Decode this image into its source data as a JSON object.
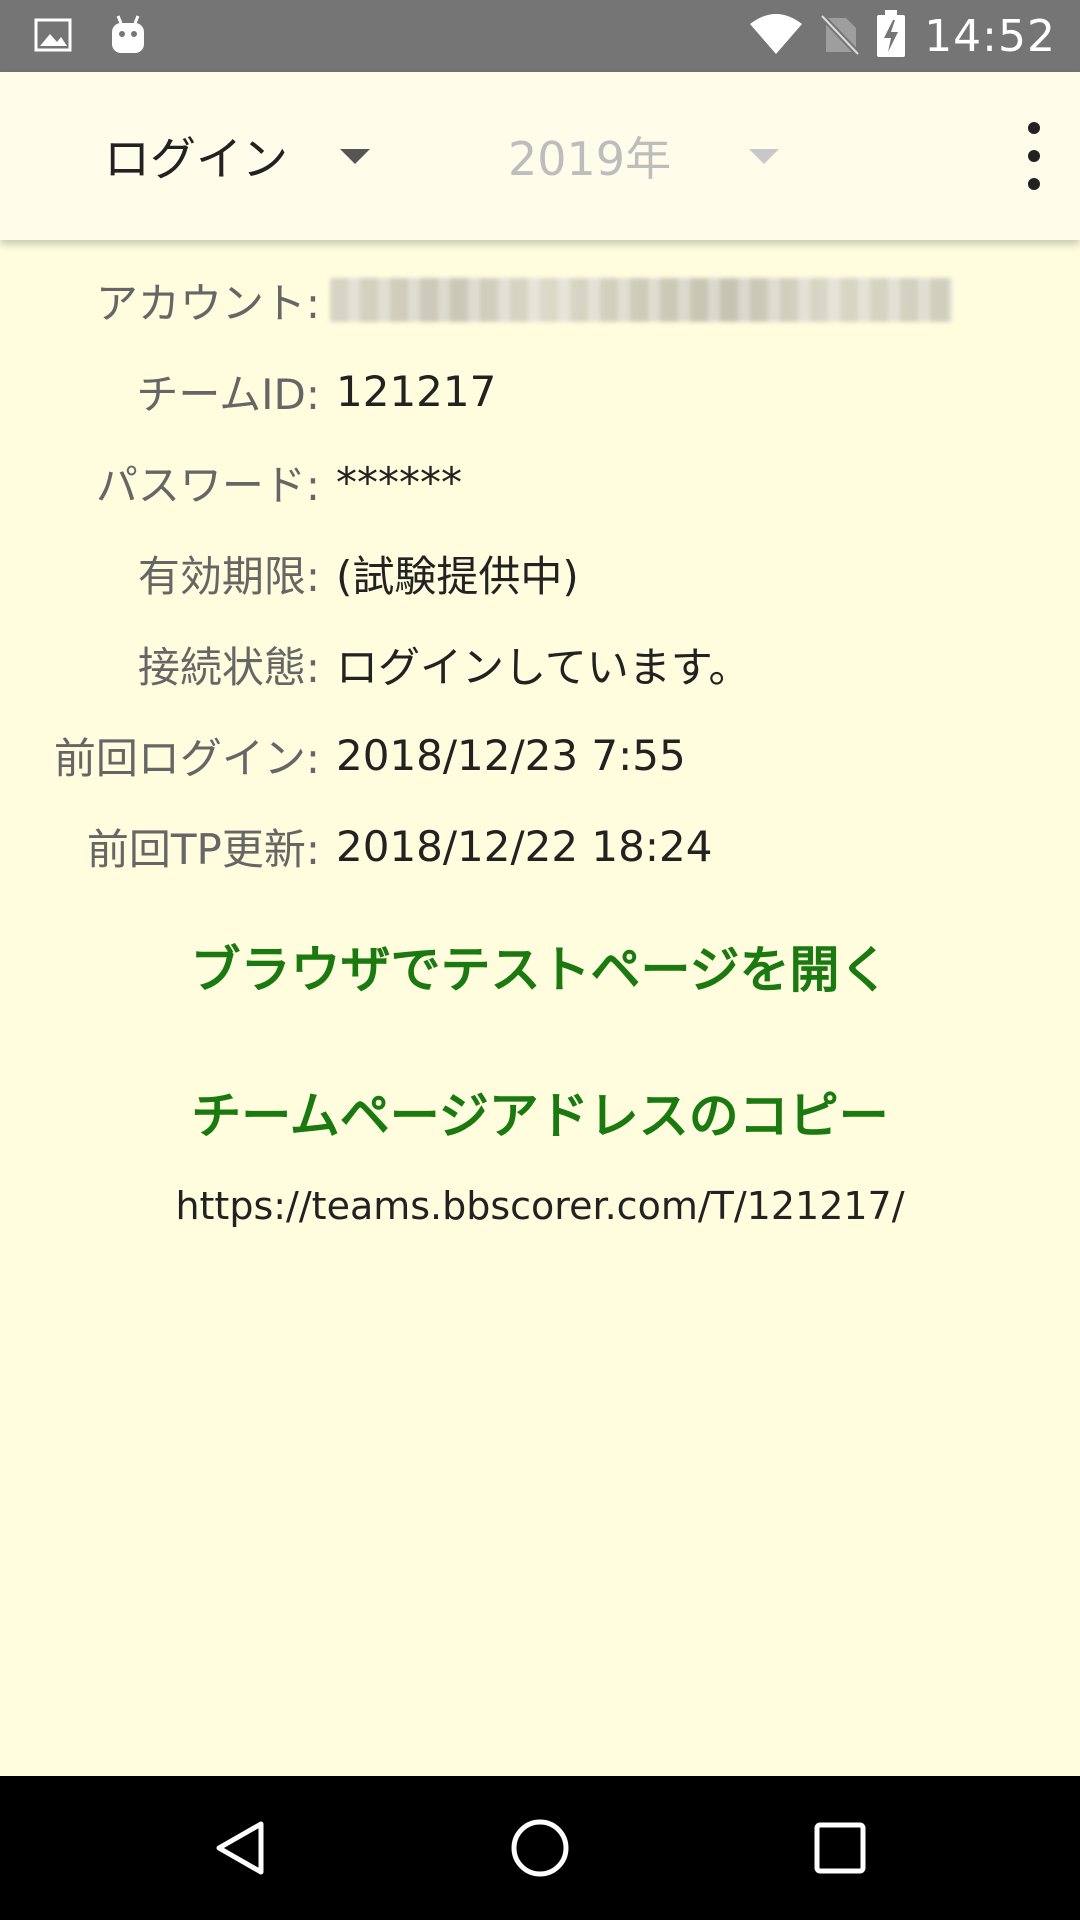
{
  "status_bar": {
    "time": "14:52",
    "icons_left": [
      "image-icon",
      "android-icon"
    ],
    "icons_right": [
      "wifi-icon",
      "no-sim-icon",
      "battery-charging-icon"
    ]
  },
  "toolbar": {
    "spinner_mode": "ログイン",
    "spinner_year": "2019年",
    "menu_icon": "more-vert-icon"
  },
  "info": {
    "account_label": "アカウント:",
    "account_value": "",
    "team_id_label": "チームID:",
    "team_id_value": "121217",
    "password_label": "パスワード:",
    "password_value": "******",
    "expiry_label": "有効期限:",
    "expiry_value": "(試験提供中)",
    "status_label": "接続状態:",
    "status_value": "ログインしています。",
    "last_login_label": "前回ログイン:",
    "last_login_value": "2018/12/23 7:55",
    "last_tp_label": "前回TP更新:",
    "last_tp_value": "2018/12/22 18:24"
  },
  "actions": {
    "open_test_page": "ブラウザでテストページを開く",
    "copy_team_address": "チームページアドレスのコピー",
    "team_url": "https://teams.bbscorer.com/T/121217/"
  },
  "colors": {
    "background": "#fffdde",
    "status_bar": "#757575",
    "link_green": "#1a7a10"
  },
  "nav_bar": {
    "icons": [
      "back-icon",
      "home-icon",
      "recents-icon"
    ]
  }
}
